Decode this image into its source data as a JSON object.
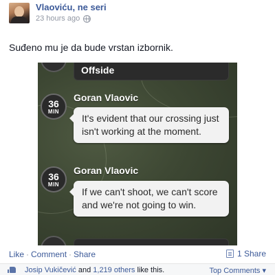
{
  "post": {
    "author": "Vlaoviću, ne seri",
    "time": "23 hours ago",
    "text": "Suđeno mu je da bude vrstan izbornik."
  },
  "photo": {
    "top_card_text": "Offside",
    "events": [
      {
        "minute": "36",
        "min_label": "MIN",
        "name": "Goran Vlaovic",
        "message": "It's evident that our crossing just isn't working at the moment."
      },
      {
        "minute": "36",
        "min_label": "MIN",
        "name": "Goran Vlaovic",
        "message": "If we can't shoot, we can't score and we're not going to win."
      }
    ]
  },
  "actions": {
    "like": "Like",
    "comment": "Comment",
    "share": "Share",
    "separator": "·",
    "share_count": "1 Share"
  },
  "likes": {
    "first_liker": "Josip Vukičević",
    "and_text": " and ",
    "others_count": "1,219 others",
    "suffix": " like this.",
    "top_comments": "Top Comments ▾"
  },
  "colors": {
    "link": "#3b5998",
    "meta": "#9197a3",
    "bubble": "#f2f2f2",
    "pitch": "#3d4733"
  },
  "icons": {
    "privacy": "globe-icon",
    "share": "share-icon",
    "like": "thumb-icon"
  }
}
